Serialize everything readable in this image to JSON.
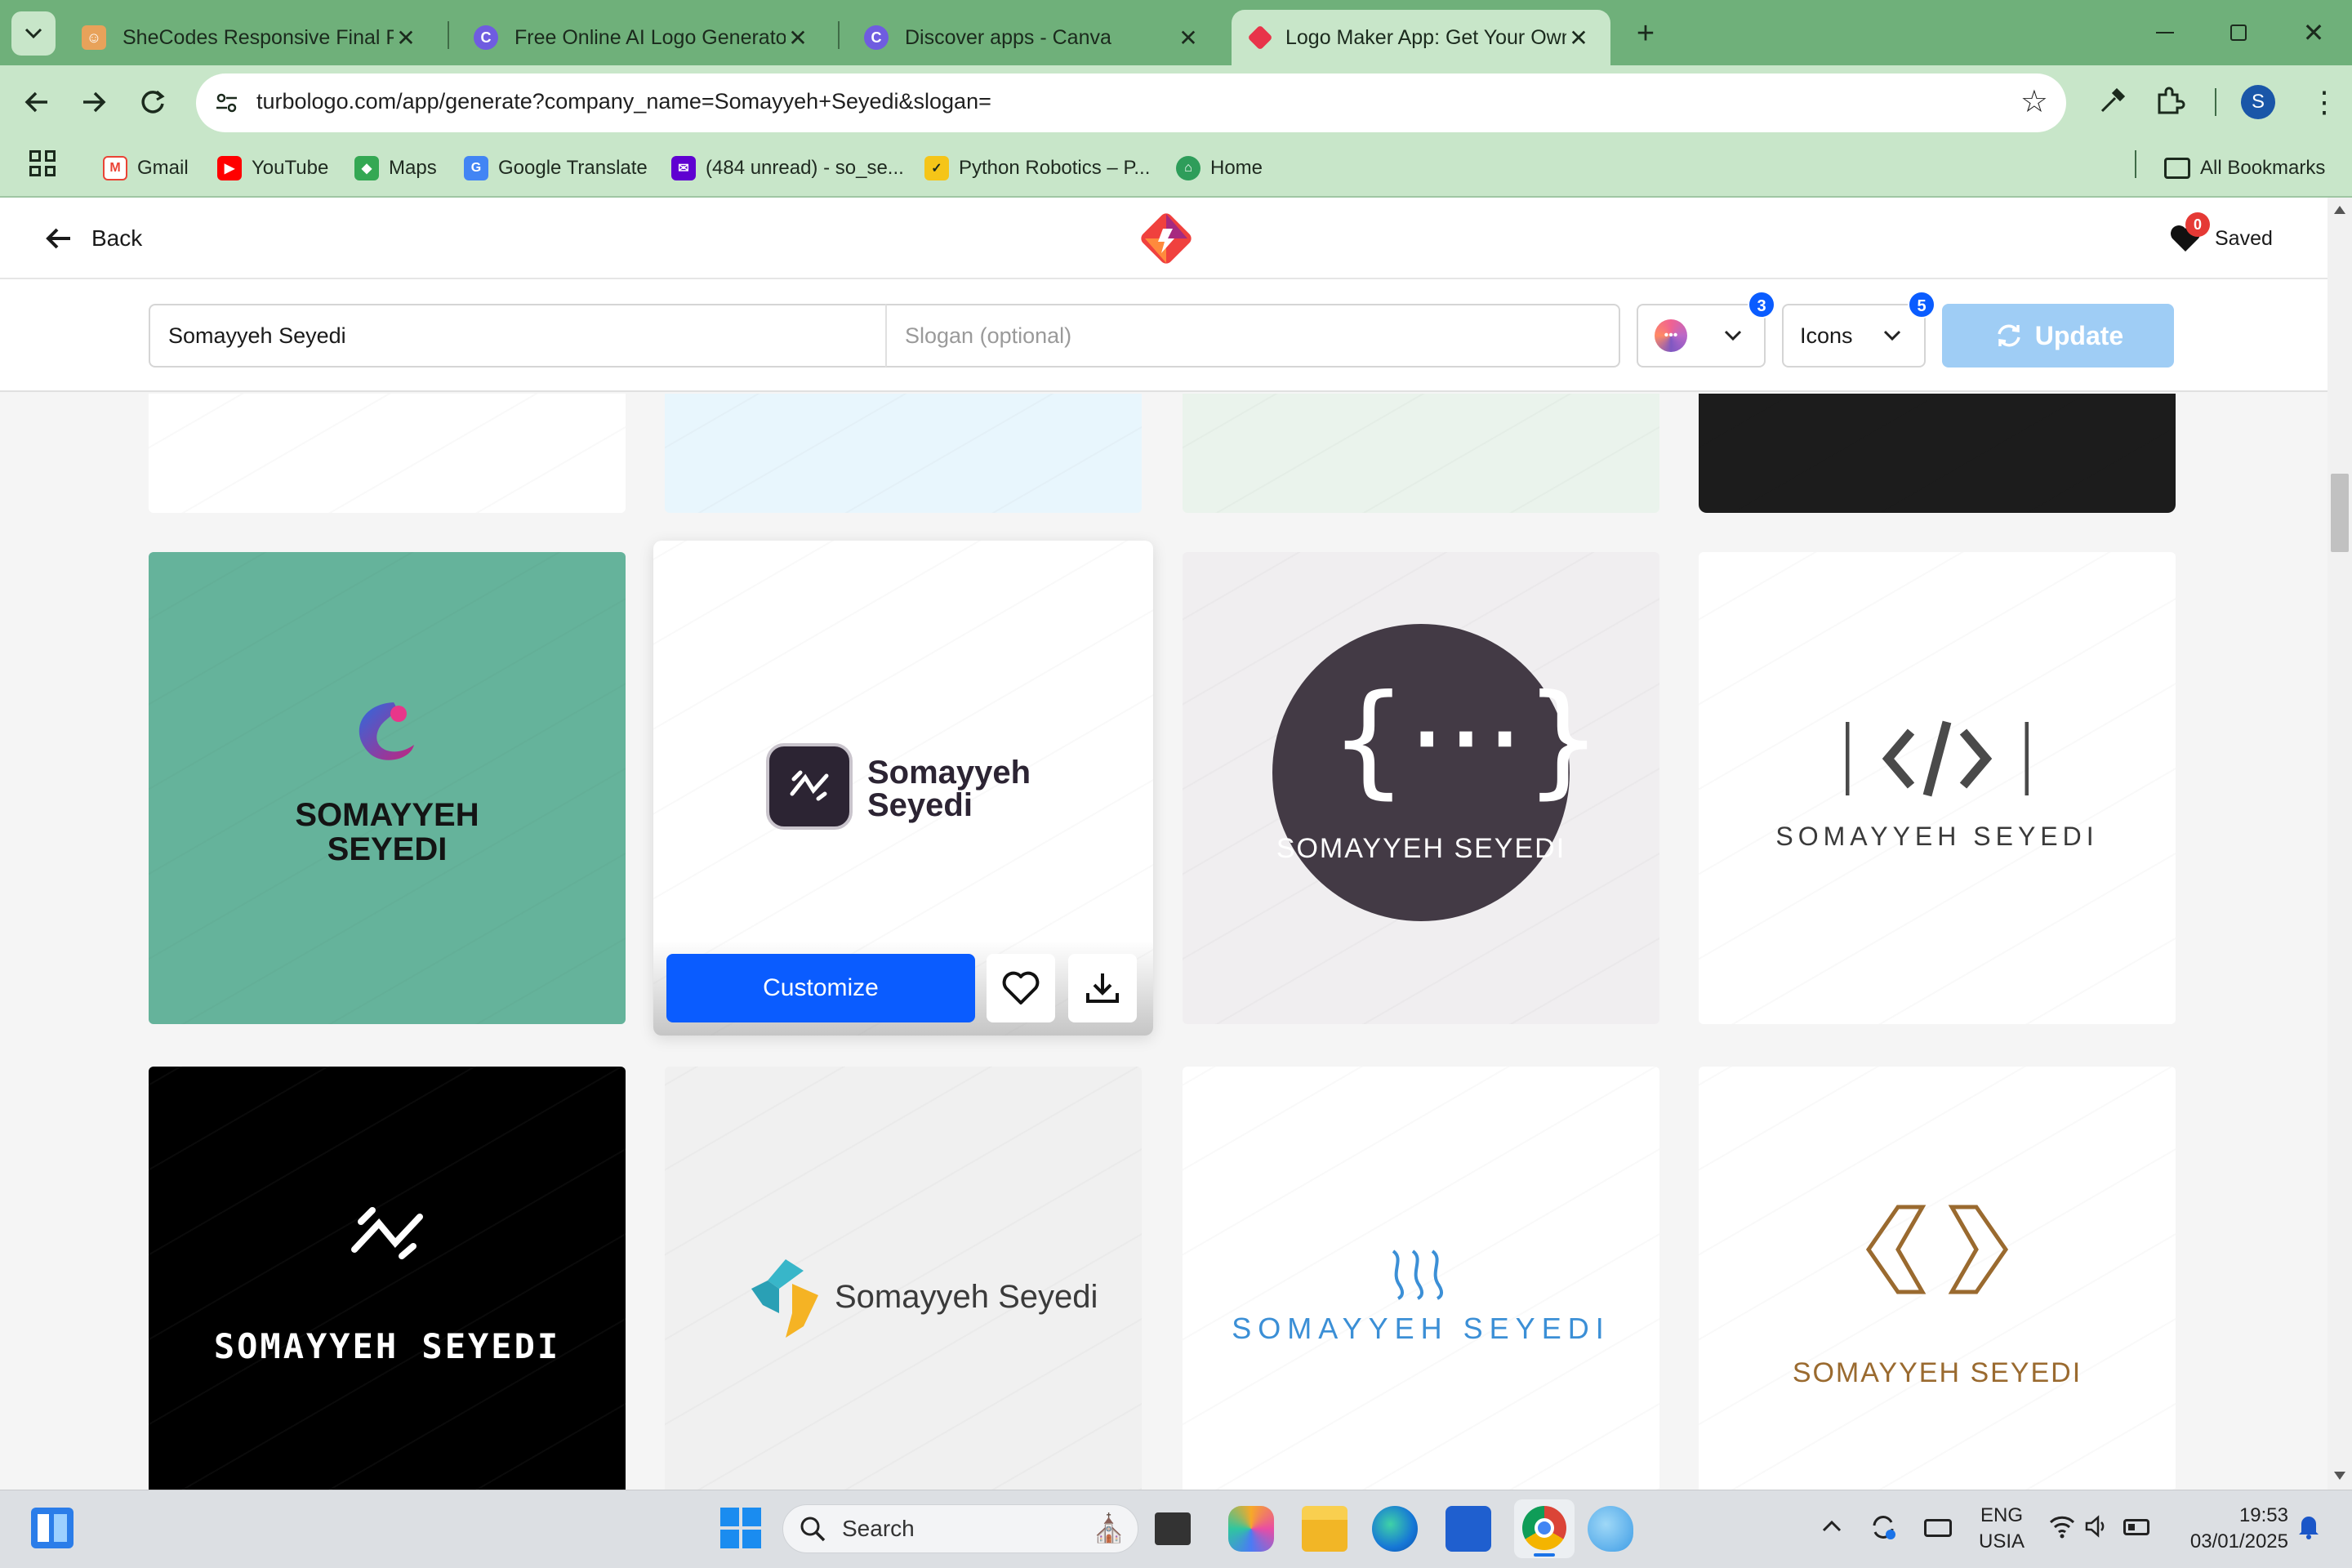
{
  "browser": {
    "tabs": [
      {
        "title": "SheCodes Responsive Final Proj",
        "icon": "shecodes-icon"
      },
      {
        "title": "Free Online AI Logo Generator",
        "icon": "canva-icon"
      },
      {
        "title": "Discover apps - Canva",
        "icon": "canva-icon"
      },
      {
        "title": "Logo Maker App: Get Your Own",
        "icon": "turbologo-icon"
      }
    ],
    "url": "turbologo.com/app/generate?company_name=Somayyeh+Seyedi&slogan=",
    "profile_initial": "S",
    "bookmarks": [
      "Gmail",
      "YouTube",
      "Maps",
      "Google Translate",
      "(484 unread) - so_se...",
      "Python Robotics – P...",
      "Home"
    ],
    "all_bookmarks": "All Bookmarks"
  },
  "header": {
    "back_label": "Back",
    "saved_label": "Saved",
    "saved_count": "0"
  },
  "form": {
    "company_name": "Somayyeh Seyedi",
    "slogan_placeholder": "Slogan (optional)",
    "colors_badge": "3",
    "icons_label": "Icons",
    "icons_badge": "5",
    "update_label": "Update"
  },
  "logos": {
    "row2": [
      {
        "line1": "SOMAYYEH",
        "line2": "SEYEDI",
        "bg": "#65b39b"
      },
      {
        "line1": "Somayyeh",
        "line2": "Seyedi",
        "bg": "#ffffff"
      },
      {
        "name": "SOMAYYEH SEYEDI",
        "bg": "#f0eef0"
      },
      {
        "name": "SOMAYYEH SEYEDI",
        "bg": "#ffffff"
      }
    ],
    "row3": [
      {
        "name": "SOMAYYEH SEYEDI",
        "bg": "#000000"
      },
      {
        "name": "Somayyeh Seyedi",
        "bg": "#f0f0f0"
      },
      {
        "name": "SOMAYYEH SEYEDI",
        "bg": "#ffffff"
      },
      {
        "name": "SOMAYYEH SEYEDI",
        "bg": "#ffffff"
      }
    ],
    "customize_label": "Customize"
  },
  "taskbar": {
    "search_placeholder": "Search",
    "lang_line1": "ENG",
    "lang_line2": "USIA",
    "time": "19:53",
    "date": "03/01/2025"
  },
  "colors": {
    "accent_blue": "#0a5cff",
    "update_button": "#9fcdf5",
    "tab_bar": "#6fb07a",
    "toolbar": "#c8e6c9"
  }
}
